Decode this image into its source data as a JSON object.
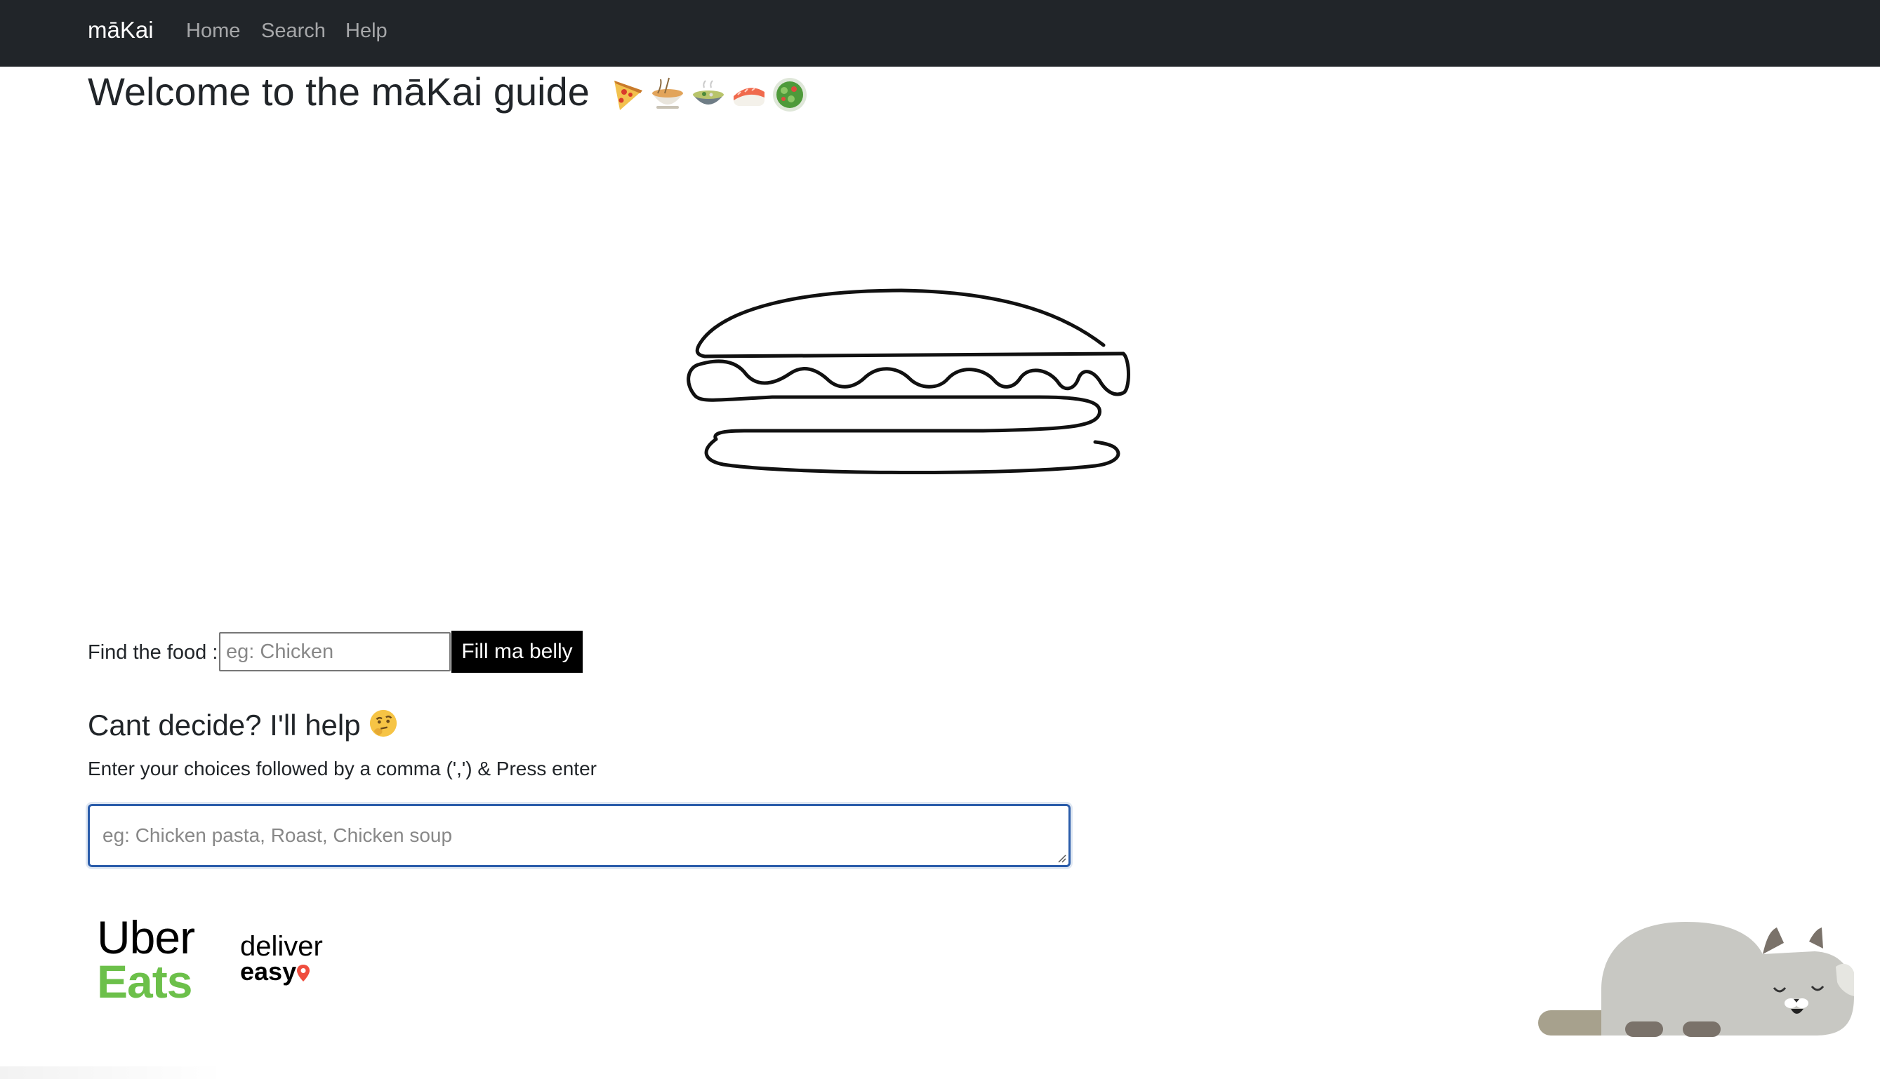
{
  "navbar": {
    "brand": "māKai",
    "links": [
      "Home",
      "Search",
      "Help"
    ]
  },
  "page": {
    "title": "Welcome to the māKai guide",
    "title_emojis": [
      "pizza-icon",
      "noodles-icon",
      "soup-bowl-icon",
      "sushi-icon",
      "salad-icon"
    ]
  },
  "search": {
    "label": "Find the food :",
    "placeholder": "eg: Chicken",
    "button": "Fill ma belly"
  },
  "decide": {
    "title": "Cant decide? I'll help",
    "title_icon": "thinking-face-icon",
    "description": "Enter your choices followed by a comma (',') & Press enter",
    "placeholder": "eg: Chicken pasta, Roast, Chicken soup"
  },
  "partners": {
    "uber_line1": "Uber",
    "uber_line2": "Eats",
    "deliver_line1": "deliver",
    "deliver_line2": "easy"
  },
  "colors": {
    "navbar_bg": "#212529",
    "uber_green": "#6cc04a",
    "focus_border": "#2a5caa",
    "cat_body": "#c8c8c3",
    "cat_tail": "#a7a18d",
    "cat_paws": "#7a726a"
  }
}
